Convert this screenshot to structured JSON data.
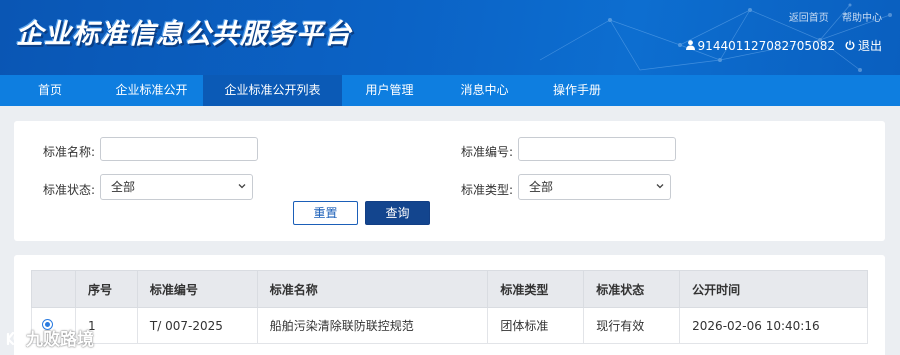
{
  "header": {
    "title": "企业标准信息公共服务平台",
    "links": [
      "返回首页",
      "帮助中心"
    ],
    "user_id": "914401127082705082",
    "logout_label": "退出",
    "icons": {
      "user": "user-icon",
      "logout": "power-icon"
    }
  },
  "nav": {
    "items": [
      "首页",
      "企业标准公开",
      "企业标准公开列表",
      "用户管理",
      "消息中心",
      "操作手册"
    ],
    "active_index": 2
  },
  "search": {
    "name_label": "标准名称:",
    "name_value": "",
    "code_label": "标准编号:",
    "code_value": "",
    "status_label": "标准状态:",
    "status_selected": "全部",
    "type_label": "标准类型:",
    "type_selected": "全部",
    "reset_label": "重置",
    "query_label": "查询"
  },
  "table": {
    "headers": [
      "",
      "序号",
      "标准编号",
      "标准名称",
      "标准类型",
      "标准状态",
      "公开时间"
    ],
    "rows": [
      {
        "selected": true,
        "index": "1",
        "code": "T/ 007-2025",
        "name": "船舶污染清除联防联控规范",
        "type": "团体标准",
        "status": "现行有效",
        "time": "2026-02-06 10:40:16"
      }
    ]
  },
  "watermark": {
    "text": "九败路境"
  },
  "colors": {
    "banner": "#0b63c6",
    "nav": "#0e7ee0",
    "nav_active": "#0b5ab6",
    "query_button": "#13458e",
    "page_bg": "#ebeef2"
  }
}
